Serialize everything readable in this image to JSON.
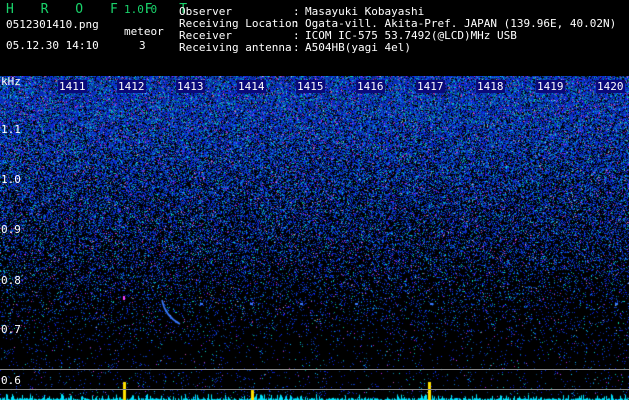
{
  "app": {
    "logo": "H R O F F T",
    "version": "1.0.0"
  },
  "file": {
    "name": "0512301410.png",
    "datetime": "05.12.30 14:10"
  },
  "meteor": {
    "label": "meteor",
    "count": "3"
  },
  "info": [
    {
      "label": "Observer",
      "value": "Masayuki Kobayashi"
    },
    {
      "label": "Receiving Location",
      "value": "Ogata-vill. Akita-Pref. JAPAN (139.96E, 40.02N)"
    },
    {
      "label": "Receiver",
      "value": "ICOM IC-575 53.7492(@LCD)MHz USB"
    },
    {
      "label": "Receiving antenna",
      "value": "A504HB(yagi 4el)"
    }
  ],
  "spectrogram": {
    "freq_unit": "kHz",
    "time_labels": [
      "1411",
      "1412",
      "1413",
      "1414",
      "1415",
      "1416",
      "1417",
      "1418",
      "1419",
      "1420"
    ],
    "freq_labels": [
      "1.1",
      "1.0",
      "0.9",
      "0.8",
      "0.7",
      "0.6"
    ],
    "colors": {
      "background": "#000000",
      "noise": "#1a3cff",
      "text": "#ffffff",
      "accent": "#19d36b",
      "echo": "#ffe000",
      "spectrum": "#00e5ff"
    }
  }
}
